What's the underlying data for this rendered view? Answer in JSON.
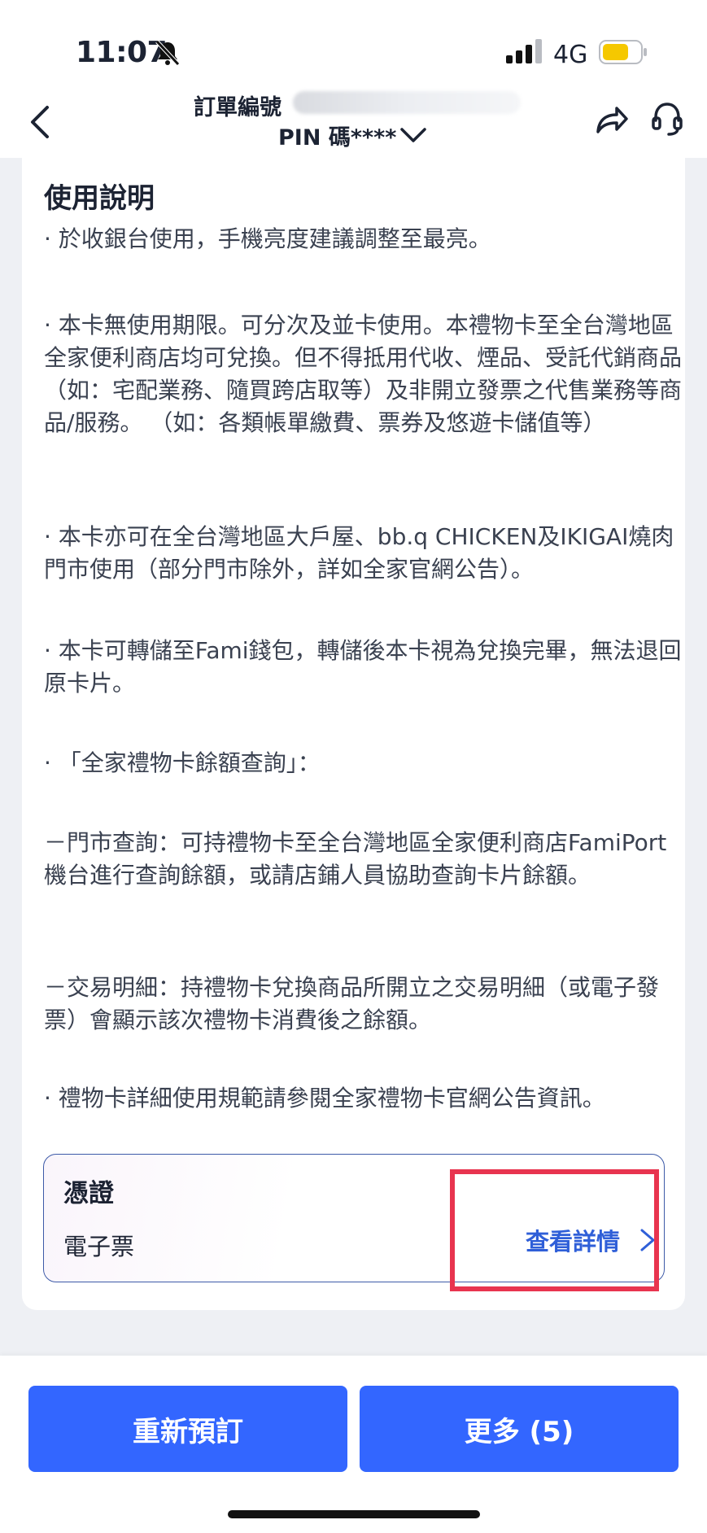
{
  "status_bar": {
    "time": "11:07",
    "network": "4G",
    "battery_color": "#f5c800"
  },
  "header": {
    "order_label": "訂單編號",
    "pin_label": "PIN 碼****"
  },
  "instructions": {
    "title": "使用說明",
    "paragraphs": [
      "· 於收銀台使用，手機亮度建議調整至最亮。",
      "· 本卡無使用期限。可分次及並卡使用。本禮物卡至全台灣地區全家便利商店均可兌換。但不得抵用代收、煙品、受託代銷商品（如：宅配業務、隨買跨店取等）及非開立發票之代售業務等商品/服務。 （如：各類帳單繳費、票券及悠遊卡儲值等）",
      "· 本卡亦可在全台灣地區大戶屋、bb.q CHICKEN及IKIGAI燒肉門市使用（部分門市除外，詳如全家官網公告）。",
      "· 本卡可轉儲至Fami錢包，轉儲後本卡視為兌換完畢，無法退回原卡片。",
      "· 「全家禮物卡餘額查詢」：",
      "－門市查詢：可持禮物卡至全台灣地區全家便利商店FamiPort機台進行查詢餘額，或請店鋪人員協助查詢卡片餘額。",
      "－交易明細：持禮物卡兌換商品所開立之交易明細（或電子發票）會顯示該次禮物卡消費後之餘額。",
      "· 禮物卡詳細使用規範請參閱全家禮物卡官網公告資訊。"
    ]
  },
  "voucher": {
    "title": "憑證",
    "type": "電子票",
    "detail_label": "查看詳情"
  },
  "actions": {
    "rebook_label": "重新預訂",
    "more_label": "更多 (5)"
  },
  "colors": {
    "accent": "#3366ff",
    "link": "#2f5fd8",
    "highlight": "#e8344f"
  },
  "icons": [
    "back-arrow-icon",
    "chevron-down-icon",
    "share-icon",
    "headset-icon",
    "bell-slash-icon",
    "signal-icon",
    "battery-icon",
    "chevron-right-icon"
  ]
}
